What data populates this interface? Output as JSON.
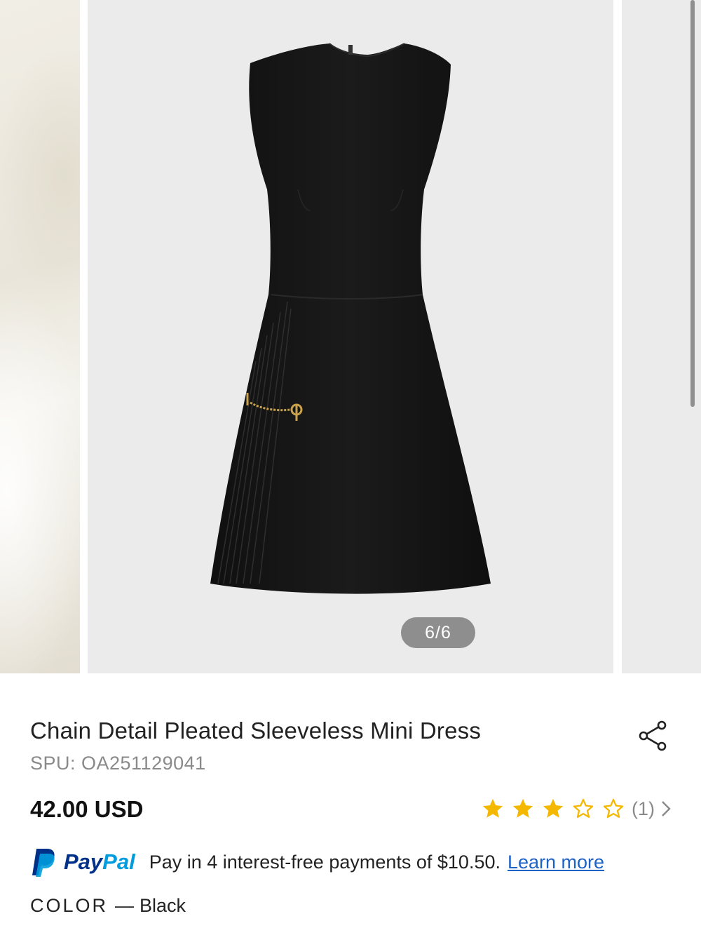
{
  "gallery": {
    "pager_text": "6/6",
    "current_index": 6,
    "total": 6
  },
  "product": {
    "title": "Chain Detail Pleated Sleeveless Mini Dress",
    "spu": "SPU: OA251129041",
    "price": "42.00 USD",
    "rating": {
      "stars_filled": 3,
      "stars_total": 5,
      "review_count": "(1)"
    },
    "share_icon": "share-icon"
  },
  "paypal": {
    "brand_pay": "Pay",
    "brand_pal": "Pal",
    "message": "Pay in 4 interest-free payments of $10.50.",
    "link": "Learn more"
  },
  "color": {
    "label": "COLOR",
    "separator": "—",
    "value": "Black"
  },
  "colors": {
    "star_fill": "#f5b800",
    "paypal_dark": "#003087",
    "paypal_light": "#009cde",
    "link": "#1d62c7",
    "pager_bg": "#8e8e8e"
  }
}
